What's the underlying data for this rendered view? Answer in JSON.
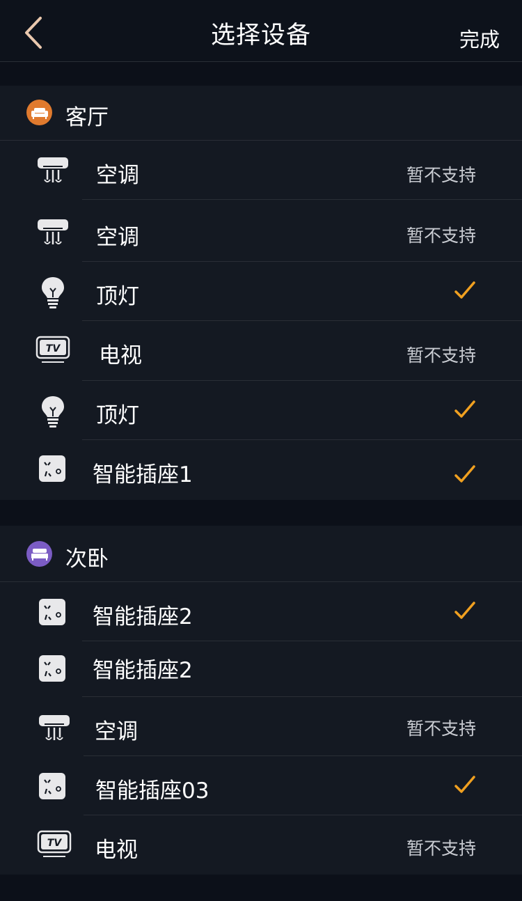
{
  "nav": {
    "title": "选择设备",
    "done_label": "完成"
  },
  "colors": {
    "accent": "#f0a020",
    "living_room": "#e07a2e",
    "bedroom": "#7b5cc4"
  },
  "sections": [
    {
      "name": "客厅",
      "icon": "sofa-icon",
      "devices": [
        {
          "name": "空调",
          "icon": "air-conditioner-icon",
          "status": "暂不支持",
          "checked": false
        },
        {
          "name": "空调",
          "icon": "air-conditioner-icon",
          "status": "暂不支持",
          "checked": false
        },
        {
          "name": "顶灯",
          "icon": "light-bulb-icon",
          "status": "",
          "checked": true
        },
        {
          "name": "电视",
          "icon": "tv-icon",
          "status": "暂不支持",
          "checked": false
        },
        {
          "name": "顶灯",
          "icon": "light-bulb-icon",
          "status": "",
          "checked": true
        },
        {
          "name": "智能插座1",
          "icon": "power-socket-icon",
          "status": "",
          "checked": true
        }
      ]
    },
    {
      "name": "次卧",
      "icon": "bed-icon",
      "devices": [
        {
          "name": "智能插座2",
          "icon": "power-socket-icon",
          "status": "",
          "checked": true
        },
        {
          "name": "智能插座2",
          "icon": "power-socket-icon",
          "status": "",
          "checked": false
        },
        {
          "name": "空调",
          "icon": "air-conditioner-icon",
          "status": "暂不支持",
          "checked": false
        },
        {
          "name": "智能插座03",
          "icon": "power-socket-icon",
          "status": "",
          "checked": true
        },
        {
          "name": "电视",
          "icon": "tv-icon",
          "status": "暂不支持",
          "checked": false
        }
      ]
    }
  ]
}
